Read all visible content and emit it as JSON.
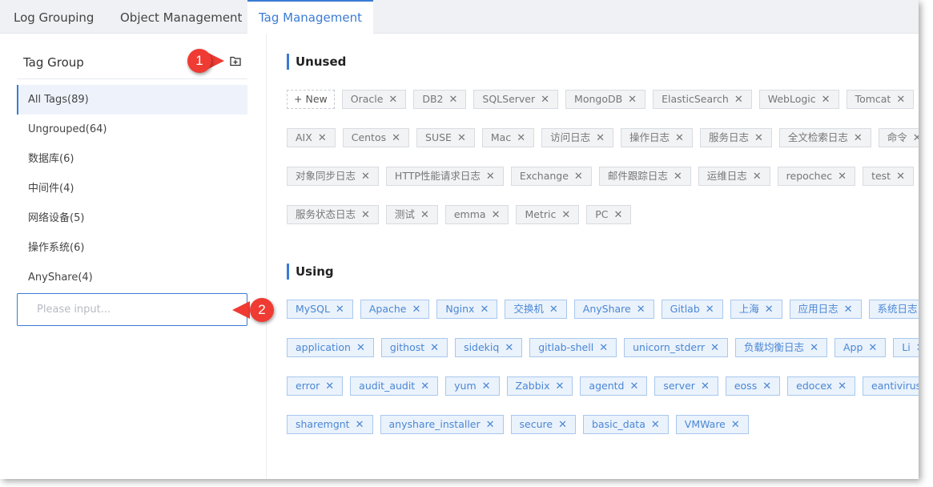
{
  "tabs": [
    {
      "label": "Log Grouping"
    },
    {
      "label": "Object Management"
    },
    {
      "label": "Tag Management"
    }
  ],
  "left_panel": {
    "title": "Tag Group",
    "groups": [
      {
        "label": "All Tags(89)"
      },
      {
        "label": "Ungrouped(64)"
      },
      {
        "label": "数据库(6)"
      },
      {
        "label": "中间件(4)"
      },
      {
        "label": "网络设备(5)"
      },
      {
        "label": "操作系统(6)"
      },
      {
        "label": "AnyShare(4)"
      }
    ],
    "input_placeholder": "Please input..."
  },
  "unused": {
    "title": "Unused",
    "new_label": "New",
    "rows": [
      [
        "Oracle",
        "DB2",
        "SQLServer",
        "MongoDB",
        "ElasticSearch",
        "WebLogic",
        "Tomcat"
      ],
      [
        "AIX",
        "Centos",
        "SUSE",
        "Mac",
        "访问日志",
        "操作日志",
        "服务日志",
        "全文检索日志",
        "命令"
      ],
      [
        "对象同步日志",
        "HTTP性能请求日志",
        "Exchange",
        "邮件跟踪日志",
        "运维日志",
        "repochec",
        "test"
      ],
      [
        "服务状态日志",
        "测试",
        "emma",
        "Metric",
        "PC"
      ]
    ]
  },
  "using": {
    "title": "Using",
    "rows": [
      [
        "MySQL",
        "Apache",
        "Nginx",
        "交换机",
        "AnyShare",
        "Gitlab",
        "上海",
        "应用日志",
        "系统日志"
      ],
      [
        "application",
        "githost",
        "sidekiq",
        "gitlab-shell",
        "unicorn_stderr",
        "负载均衡日志",
        "App",
        "Li"
      ],
      [
        "error",
        "audit_audit",
        "yum",
        "Zabbix",
        "agentd",
        "server",
        "eoss",
        "edocex",
        "eantivirus"
      ],
      [
        "sharemgnt",
        "anyshare_installer",
        "secure",
        "basic_data",
        "VMWare"
      ]
    ]
  },
  "callouts": {
    "one": "1",
    "two": "2"
  },
  "icons": {
    "close": "close-icon",
    "plus": "plus-icon",
    "add_folder": "add-folder-icon"
  },
  "colors": {
    "accent": "#3a7bd5",
    "callout": "#ef3b33"
  }
}
